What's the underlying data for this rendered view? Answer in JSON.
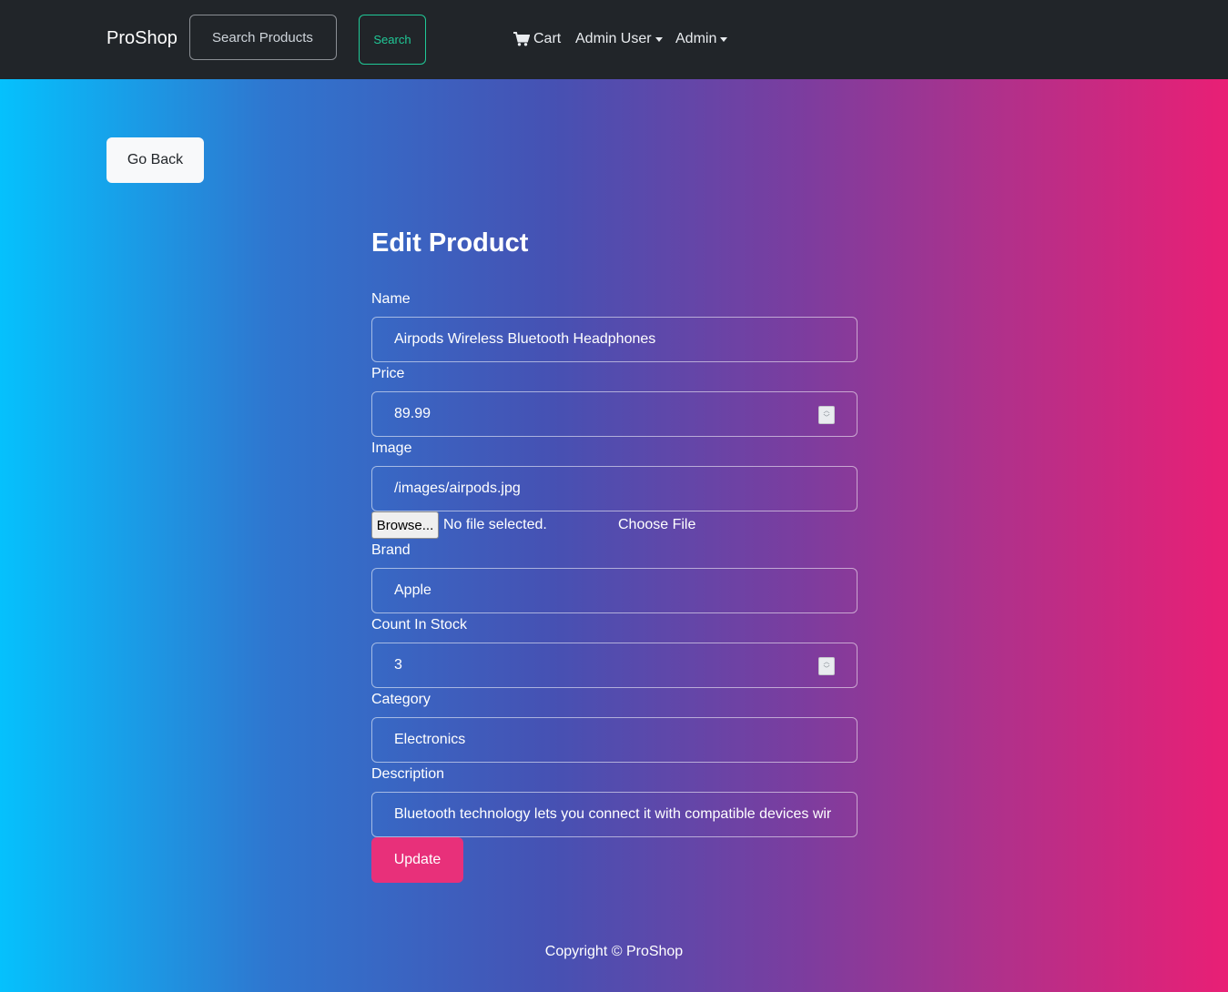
{
  "nav": {
    "brand": "ProShop",
    "search_placeholder": "Search Products",
    "search_button": "Search",
    "cart": "Cart",
    "admin_user": "Admin User",
    "admin": "Admin"
  },
  "page": {
    "go_back": "Go Back",
    "title": "Edit Product"
  },
  "form": {
    "name_label": "Name",
    "name_value": "Airpods Wireless Bluetooth Headphones",
    "price_label": "Price",
    "price_value": "89.99",
    "image_label": "Image",
    "image_value": "/images/airpods.jpg",
    "browse_button": "Browse...",
    "file_status": "No file selected.",
    "choose_file": "Choose File",
    "brand_label": "Brand",
    "brand_value": "Apple",
    "count_label": "Count In Stock",
    "count_value": "3",
    "category_label": "Category",
    "category_value": "Electronics",
    "description_label": "Description",
    "description_value": "Bluetooth technology lets you connect it with compatible devices wir",
    "update_button": "Update"
  },
  "footer": {
    "copyright": "Copyright © ProShop"
  },
  "colors": {
    "navbar_bg": "#212529",
    "search_accent": "#20c997",
    "update_button": "#e8307a",
    "gradient_start": "#05c1fd",
    "gradient_end": "#e91f75"
  },
  "icons": {
    "cart": "shopping-cart-icon"
  }
}
